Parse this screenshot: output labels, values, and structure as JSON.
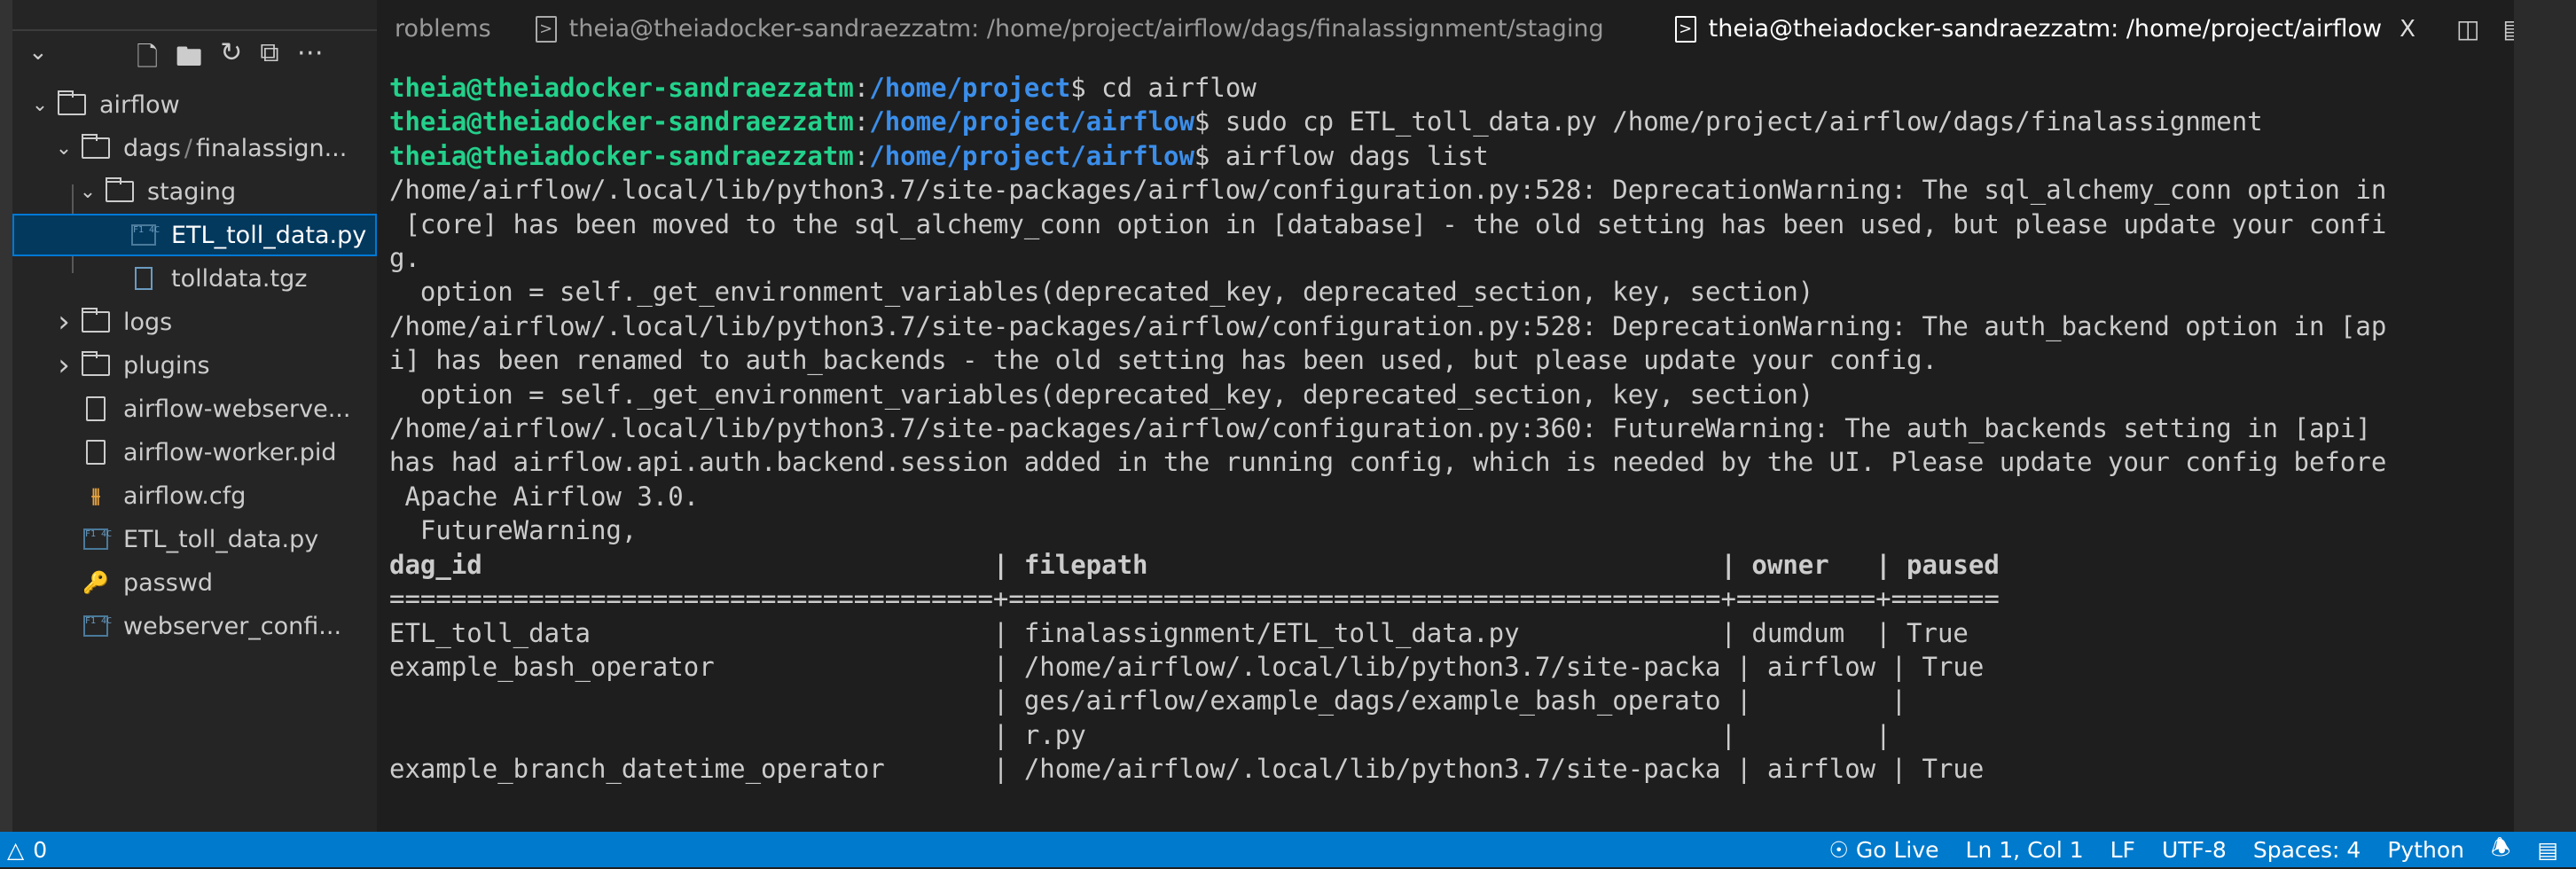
{
  "sidebar": {
    "actions": [
      "new-file",
      "new-folder",
      "refresh",
      "collapse-all",
      "more"
    ],
    "items": [
      {
        "label": "airflow",
        "type": "folder",
        "expanded": true
      },
      {
        "label": "dags",
        "sep": "/",
        "label2": "finalassign...",
        "type": "folder",
        "expanded": true
      },
      {
        "label": "staging",
        "type": "folder",
        "expanded": true
      },
      {
        "label": "ETL_toll_data.py",
        "type": "py",
        "selected": true
      },
      {
        "label": "tolldata.tgz",
        "type": "archive"
      },
      {
        "label": "logs",
        "type": "folder",
        "expanded": false
      },
      {
        "label": "plugins",
        "type": "folder",
        "expanded": false
      },
      {
        "label": "airflow-webserve...",
        "type": "file"
      },
      {
        "label": "airflow-worker.pid",
        "type": "file"
      },
      {
        "label": "airflow.cfg",
        "type": "cfg"
      },
      {
        "label": "ETL_toll_data.py",
        "type": "py"
      },
      {
        "label": "passwd",
        "type": "key"
      },
      {
        "label": "webserver_confi...",
        "type": "py"
      }
    ]
  },
  "tabs": [
    {
      "label": "roblems"
    },
    {
      "label": "theia@theiadocker-sandraezzatm: /home/project/airflow/dags/finalassignment/staging"
    },
    {
      "label": "theia@theiadocker-sandraezzatm: /home/project/airflow",
      "active": true,
      "close": "X"
    }
  ],
  "terminal": {
    "user": "theia@theiadocker-sandraezzatm",
    "cmds": [
      {
        "path": "/home/project",
        "cmd": " cd airflow"
      },
      {
        "path": "/home/project/airflow",
        "cmd": " sudo cp ETL_toll_data.py /home/project/airflow/dags/finalassignment"
      },
      {
        "path": "/home/project/airflow",
        "cmd": " airflow dags list"
      }
    ],
    "output": [
      "/home/airflow/.local/lib/python3.7/site-packages/airflow/configuration.py:528: DeprecationWarning: The sql_alchemy_conn option in",
      " [core] has been moved to the sql_alchemy_conn option in [database] - the old setting has been used, but please update your confi",
      "g.",
      "  option = self._get_environment_variables(deprecated_key, deprecated_section, key, section)",
      "/home/airflow/.local/lib/python3.7/site-packages/airflow/configuration.py:528: DeprecationWarning: The auth_backend option in [ap",
      "i] has been renamed to auth_backends - the old setting has been used, but please update your config.",
      "  option = self._get_environment_variables(deprecated_key, deprecated_section, key, section)",
      "/home/airflow/.local/lib/python3.7/site-packages/airflow/configuration.py:360: FutureWarning: The auth_backends setting in [api]",
      "has had airflow.api.auth.backend.session added in the running config, which is needed by the UI. Please update your config before",
      " Apache Airflow 3.0.",
      "  FutureWarning,"
    ],
    "table_header": "dag_id                                 | filepath                                     | owner   | paused",
    "table_sep": "=======================================+==============================================+=========+=======",
    "table_rows": [
      "ETL_toll_data                          | finalassignment/ETL_toll_data.py             | dumdum  | True",
      "example_bash_operator                  | /home/airflow/.local/lib/python3.7/site-packa | airflow | True",
      "                                       | ges/airflow/example_dags/example_bash_operato |         |",
      "                                       | r.py                                         |         |",
      "example_branch_datetime_operator       | /home/airflow/.local/lib/python3.7/site-packa | airflow | True"
    ]
  },
  "statusbar": {
    "warnings": "0",
    "go_live": "Go Live",
    "position": "Ln 1, Col 1",
    "eol": "LF",
    "encoding": "UTF-8",
    "spaces": "Spaces: 4",
    "language": "Python"
  },
  "colors": {
    "accent": "#007acc",
    "prompt_user": "#23d18b",
    "prompt_path": "#3b8eea"
  }
}
